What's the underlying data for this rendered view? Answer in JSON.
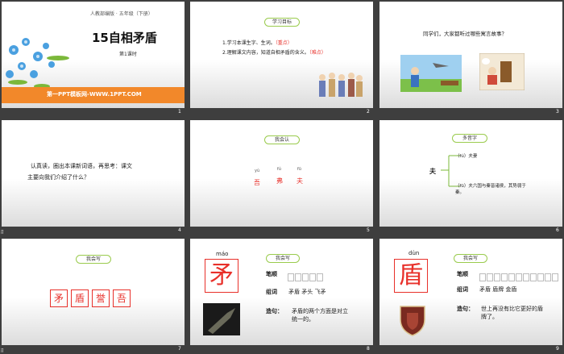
{
  "slide1": {
    "series": "人教部编版 · 五年级（下册）",
    "title": "15自相矛盾",
    "lesson": "第1课时",
    "footer": "第一PPT模板网-WWW.1PPT.COM",
    "num": "1"
  },
  "slide2": {
    "pill": "学习目标",
    "goal1": "1.学习本课生字、生词。",
    "goal1_tag": "（重点）",
    "goal2": "2.理解课文内容，知道自相矛盾的含义。",
    "goal2_tag": "（难点）",
    "num": "2"
  },
  "slide3": {
    "question": "同学们，大家都听过哪些寓言故事？",
    "num": "3"
  },
  "slide4": {
    "line1": "认真读，圈出本课新词语，再思考：课文",
    "line2": "主要向我们介绍了什么？",
    "num": "4"
  },
  "slide5": {
    "pill": "我会认",
    "chars": [
      {
        "py": "yù",
        "ch": "吾"
      },
      {
        "py": "fú",
        "ch": "弗"
      },
      {
        "py": "fū",
        "ch": "夫"
      }
    ],
    "num": "5"
  },
  "slide6": {
    "pill": "多音字",
    "char": "夫",
    "item1": "（fú）夫妻",
    "item2": "（fū）夫六国与秦皆诸侯，其势弱于秦。",
    "num": "6"
  },
  "slide7": {
    "pill": "我会写",
    "chars": [
      "矛",
      "盾",
      "誉",
      "吾"
    ],
    "num": "7"
  },
  "slide8": {
    "pinyin": "máo",
    "char": "矛",
    "pill": "我会写",
    "stroke_label": "笔顺",
    "words_label": "组词",
    "words": "矛盾 矛头 飞矛",
    "sentence_label": "造句：",
    "sentence": "矛盾的两个方面是对立统一的。",
    "num": "8"
  },
  "slide9": {
    "pinyin": "dùn",
    "char": "盾",
    "pill": "我会写",
    "stroke_label": "笔顺",
    "words_label": "组词",
    "words": "矛盾 盾牌 金盾",
    "sentence_label": "造句：",
    "sentence": "世上再没有比它更好的盾牌了。",
    "num": "9"
  },
  "left_markers": {
    "row2": "ïî",
    "row3": "ïî"
  }
}
